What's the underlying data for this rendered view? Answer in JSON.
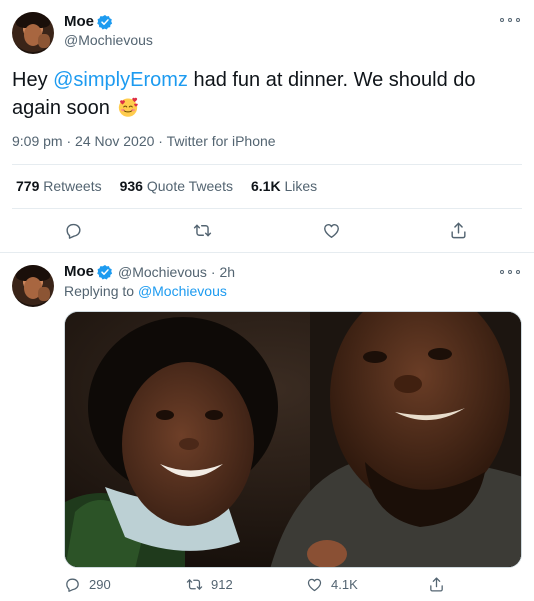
{
  "main_tweet": {
    "author_name": "Moe",
    "handle": "@Mochievous",
    "text_before": "Hey ",
    "mention": "@simplyEromz",
    "text_after": " had fun at dinner. We should do again soon",
    "timestamp": "9:09 pm · 24 Nov 2020",
    "separator": " · ",
    "source": "Twitter for iPhone",
    "stats": {
      "retweets_count": "779",
      "retweets_label": "Retweets",
      "quote_count": "936",
      "quote_label": "Quote Tweets",
      "likes_count": "6.1K",
      "likes_label": "Likes"
    }
  },
  "reply_tweet": {
    "author_name": "Moe",
    "handle": "@Mochievous",
    "time": "· 2h",
    "replying_label": "Replying to ",
    "replying_to": "@Mochievous",
    "reply_count": "290",
    "retweet_count": "912",
    "like_count": "4.1K"
  },
  "colors": {
    "accent": "#1d9bf0",
    "secondary_text": "#536471",
    "divider": "#e6ecf0"
  },
  "icons": {
    "verified": "verified-badge-icon",
    "more": "more-options-icon",
    "reply": "reply-icon",
    "retweet": "retweet-icon",
    "like": "heart-icon",
    "share": "share-icon",
    "emoji": "smiling-face-with-hearts-emoji"
  }
}
